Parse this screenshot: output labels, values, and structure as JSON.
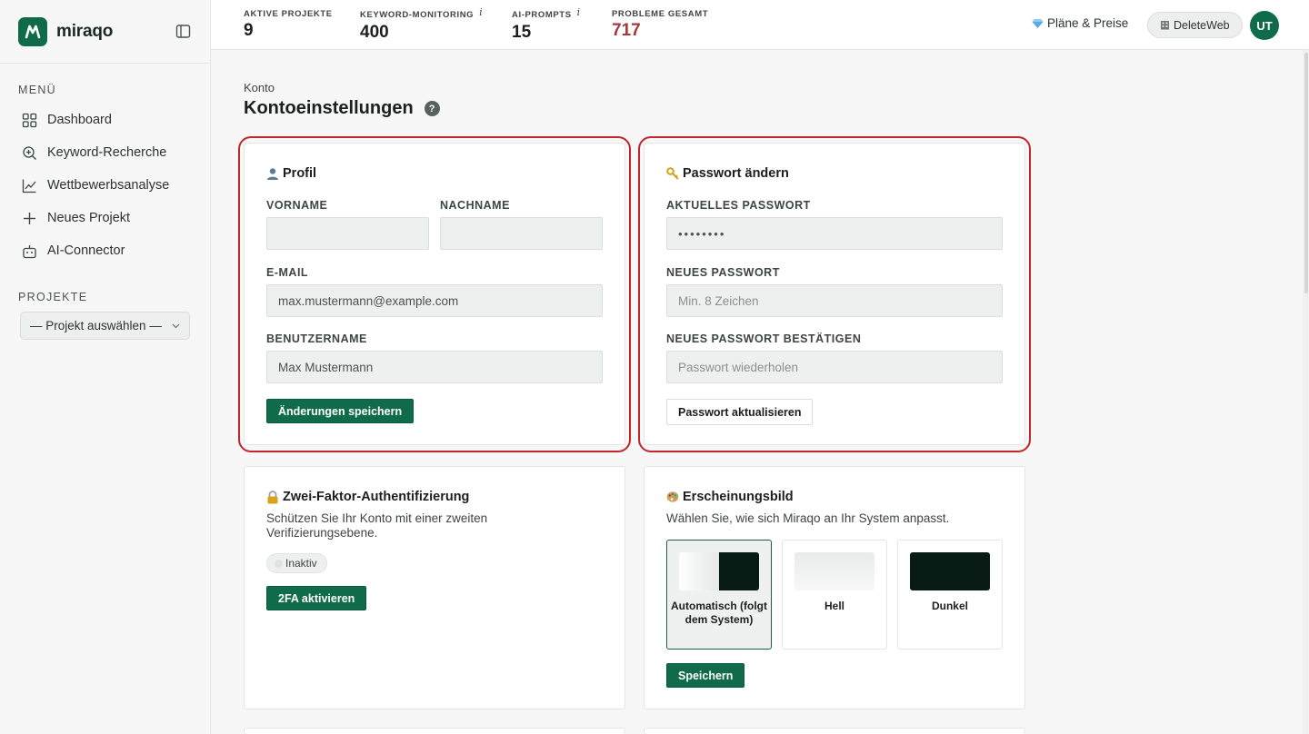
{
  "brand": {
    "name": "miraqo"
  },
  "sidebar": {
    "menu_title": "MENÜ",
    "items": [
      {
        "label": "Dashboard",
        "icon": "dashboard-grid-icon"
      },
      {
        "label": "Keyword-Recherche",
        "icon": "search-plus-icon"
      },
      {
        "label": "Wettbewerbsanalyse",
        "icon": "line-chart-icon"
      },
      {
        "label": "Neues Projekt",
        "icon": "plus-icon"
      },
      {
        "label": "AI-Connector",
        "icon": "robot-icon"
      }
    ],
    "projects_title": "PROJEKTE",
    "project_select": "— Projekt auswählen —"
  },
  "topbar": {
    "stats": [
      {
        "label": "AKTIVE PROJEKTE",
        "value": "9"
      },
      {
        "label": "KEYWORD-MONITORING",
        "value": "400"
      },
      {
        "label": "AI-PROMPTS",
        "value": "15"
      },
      {
        "label": "PROBLEME GESAMT",
        "value": "717"
      }
    ],
    "info_glyph": "i",
    "plans_label": "Pläne & Preise",
    "workspace_label": "DeleteWeb",
    "avatar_initials": "UT"
  },
  "page": {
    "breadcrumb": "Konto",
    "title": "Kontoeinstellungen",
    "help": "?"
  },
  "profile": {
    "title": "Profil",
    "first_name_label": "VORNAME",
    "first_name_value": "",
    "last_name_label": "NACHNAME",
    "last_name_value": "",
    "email_label": "E-MAIL",
    "email_value": "max.mustermann@example.com",
    "username_label": "BENUTZERNAME",
    "username_value": "Max Mustermann",
    "save_button": "Änderungen speichern"
  },
  "password": {
    "title": "Passwort ändern",
    "current_label": "AKTUELLES PASSWORT",
    "current_value": "••••••••",
    "new_label": "NEUES PASSWORT",
    "new_placeholder": "Min. 8 Zeichen",
    "confirm_label": "NEUES PASSWORT BESTÄTIGEN",
    "confirm_placeholder": "Passwort wiederholen",
    "update_button": "Passwort aktualisieren"
  },
  "two_factor": {
    "title": "Zwei-Faktor-Authentifizierung",
    "description": "Schützen Sie Ihr Konto mit einer zweiten Verifizierungsebene.",
    "status": "Inaktiv",
    "activate_button": "2FA aktivieren"
  },
  "appearance": {
    "title": "Erscheinungsbild",
    "description": "Wählen Sie, wie sich Miraqo an Ihr System anpasst.",
    "options": [
      {
        "label": "Automatisch (folgt dem System)",
        "selected": true
      },
      {
        "label": "Hell",
        "selected": false
      },
      {
        "label": "Dunkel",
        "selected": false
      }
    ],
    "save_button": "Speichern"
  },
  "colors": {
    "brand_green": "#0f6b4a",
    "highlight_red": "#c0272d",
    "problems_red": "#a23a3c",
    "dark_theme": "#071a13"
  }
}
